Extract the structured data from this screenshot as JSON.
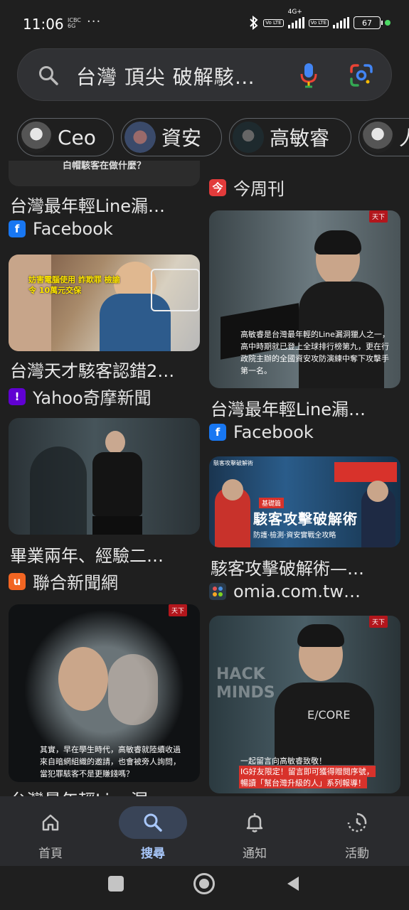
{
  "status": {
    "time": "11:06",
    "mini_label": "ICBC 6G",
    "dots": "···",
    "network": "4G+",
    "volte": "Vo LTE",
    "battery": "67"
  },
  "search": {
    "query": "台灣 頂尖 破解駭…"
  },
  "chips": [
    {
      "label": "Ceo"
    },
    {
      "label": "資安"
    },
    {
      "label": "高敏睿"
    },
    {
      "label": "人"
    }
  ],
  "results": {
    "left": [
      {
        "image_caption": "白帽駭客在做什麼？",
        "title": "台灣最年輕Line漏…",
        "source": "Facebook",
        "favicon": "f"
      },
      {
        "image_caption": "妨害電腦使用 詐欺罪 檢諭令 10萬元交保",
        "title": "台灣天才駭客認錯2…",
        "source": "Yahoo奇摩新聞",
        "favicon": "!"
      },
      {
        "title": "畢業兩年、經驗二…",
        "source": "聯合新聞網",
        "favicon": "u"
      },
      {
        "image_caption": "其實，早在學生時代，高敏睿就陸續收過來自暗網組織的邀請，也會被旁人詢問，當犯罪駭客不是更賺錢嗎？",
        "brand": "天下",
        "title": "台灣最年輕Line漏…"
      }
    ],
    "right": [
      {
        "title_partial": "…",
        "source": "今周刊",
        "favicon": "今"
      },
      {
        "image_caption": "高敏睿是台灣最年輕的Line漏洞獵人之一，高中時期就已登上全球排行榜第九，更在行政院主辦的全國資安攻防演練中奪下攻擊手第一名。",
        "brand": "天下",
        "title": "台灣最年輕Line漏…",
        "source": "Facebook",
        "favicon": "f"
      },
      {
        "image_heading": "駭客攻擊破解術",
        "image_sub": "防護·檢測·資安實戰全攻略",
        "image_top": "駭客攻擊破解術",
        "image_tag": "基礎篇",
        "title": "駭客攻擊破解術—…",
        "source": "omia.com.tw…",
        "favicon": "o"
      },
      {
        "image_caption_1": "一起留言向高敏睿致敬！",
        "image_caption_2": "IG好友限定！留言即可獲得贈閱序號，",
        "image_caption_3": "暢讀「幫台灣升級的人」系列報導！",
        "brand": "天下",
        "sign": "HACK MINDS",
        "shirt": "E/CORE"
      }
    ]
  },
  "nav": [
    {
      "label": "首頁",
      "icon": "home-icon"
    },
    {
      "label": "搜尋",
      "icon": "search-icon"
    },
    {
      "label": "通知",
      "icon": "bell-icon"
    },
    {
      "label": "活動",
      "icon": "activity-icon"
    }
  ],
  "colors": {
    "background": "#1f1f1f",
    "accent": "#a8c7fa",
    "active_pill": "#394457"
  }
}
